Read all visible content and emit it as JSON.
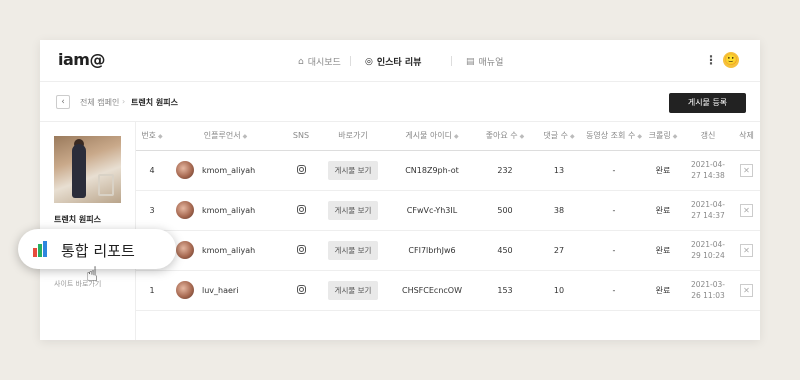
{
  "header": {
    "logo": "iam@",
    "nav": [
      {
        "icon": "home-icon",
        "glyph": "⌂",
        "label": "대시보드"
      },
      {
        "icon": "instagram-icon",
        "glyph": "◎",
        "label": "인스타 리뷰"
      },
      {
        "icon": "manual-icon",
        "glyph": "▤",
        "label": "매뉴얼"
      }
    ],
    "more_glyph": "⋮",
    "profile_glyph": "🙂"
  },
  "breadcrumb": {
    "back_glyph": "‹",
    "parent": "전체 캠페인",
    "separator": "›",
    "current": "트렌치 원피스"
  },
  "register_button": "게시물 등록",
  "campaign": {
    "name": "트렌치 원피스",
    "site_link": "사이트 바로가기"
  },
  "table": {
    "sort_glyph": "◆",
    "columns": [
      "번호",
      "인플루언서",
      "SNS",
      "바로가기",
      "게시물 아이디",
      "좋아요 수",
      "댓글 수",
      "동영상 조회 수",
      "크롤링",
      "갱신",
      "삭제"
    ],
    "rows": [
      {
        "no": "4",
        "influencer": "kmom_aliyah",
        "sns": "instagram",
        "link": "게시물 보기",
        "post_id": "CN18Z9ph-ot",
        "likes": "232",
        "comments": "13",
        "views": "-",
        "crawling": "완료",
        "updated_date": "2021-04-",
        "updated_time": "27 14:38",
        "delete": "✕"
      },
      {
        "no": "3",
        "influencer": "kmom_aliyah",
        "sns": "instagram",
        "link": "게시물 보기",
        "post_id": "CFwVc-Yh3IL",
        "likes": "500",
        "comments": "38",
        "views": "-",
        "crawling": "완료",
        "updated_date": "2021-04-",
        "updated_time": "27 14:37",
        "delete": "✕"
      },
      {
        "no": "2",
        "influencer": "kmom_aliyah",
        "sns": "instagram",
        "link": "게시물 보기",
        "post_id": "CFI7lbrhJw6",
        "likes": "450",
        "comments": "27",
        "views": "-",
        "crawling": "완료",
        "updated_date": "2021-04-",
        "updated_time": "29 10:24",
        "delete": "✕"
      },
      {
        "no": "1",
        "influencer": "luv_haeri",
        "sns": "instagram",
        "link": "게시물 보기",
        "post_id": "CHSFCEcncOW",
        "likes": "153",
        "comments": "10",
        "views": "-",
        "crawling": "완료",
        "updated_date": "2021-03-",
        "updated_time": "26 11:03",
        "delete": "✕"
      }
    ]
  },
  "report_button": {
    "label": "통합 리포트",
    "icon": "bar-chart-icon"
  },
  "cursor_glyph": "☝",
  "colors": {
    "background": "#efece6",
    "primary_button": "#222222",
    "chart_bars": [
      "#e74c3c",
      "#27ae60",
      "#2e86de"
    ]
  }
}
